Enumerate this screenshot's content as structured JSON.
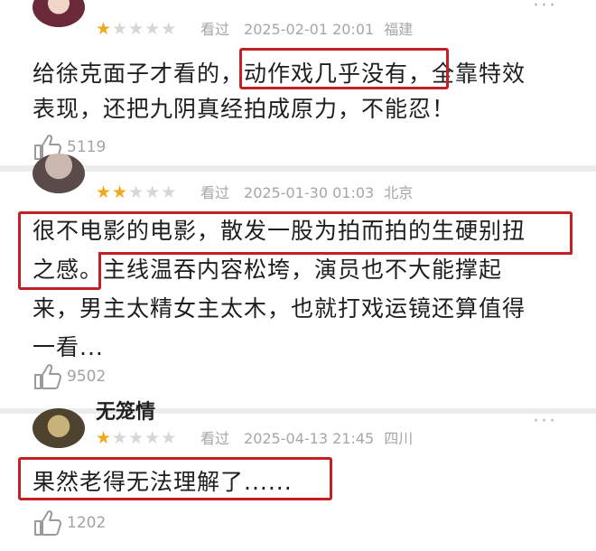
{
  "reviews": [
    {
      "stars_filled": 1,
      "stars_total": 5,
      "seen_label": "看过",
      "time": "2025-02-01 20:01",
      "region": "福建",
      "text_lines": [
        "给徐克面子才看的，动作戏几乎没有，全靠特效",
        "表现，还把九阴真经拍成原力，不能忍！"
      ],
      "highlight": "动作戏几乎没有，",
      "likes": "5119"
    },
    {
      "stars_filled": 2,
      "stars_total": 5,
      "seen_label": "看过",
      "time": "2025-01-30 01:03",
      "region": "北京",
      "text_lines": [
        "很不电影的电影，散发一股为拍而拍的生硬别扭",
        "之感。主线温吞内容松垮，演员也不大能撑起",
        "来，男主太精女主太木，也就打戏运镜还算值得",
        "一看..."
      ],
      "likes": "9502"
    },
    {
      "name_partial": "无笼情",
      "stars_filled": 1,
      "stars_total": 5,
      "seen_label": "看过",
      "time": "2025-04-13 21:45",
      "region": "四川",
      "text_lines": [
        "果然老得无法理解了......"
      ],
      "likes": "1202"
    }
  ],
  "icons": {
    "more": "more-dots-icon",
    "like": "thumb-up-icon"
  },
  "colors": {
    "highlight_border": "#c42024",
    "star_on": "#f0a81c",
    "star_off": "#d6d6d6",
    "meta_text": "#a6a6a6"
  }
}
